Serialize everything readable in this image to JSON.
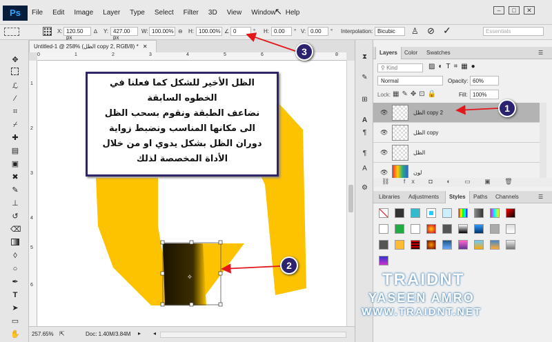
{
  "app": {
    "logo": "Ps"
  },
  "menu": [
    "File",
    "Edit",
    "Image",
    "Layer",
    "Type",
    "Select",
    "Filter",
    "3D",
    "View",
    "Window",
    "Help"
  ],
  "window_controls": [
    "–",
    "□",
    "✕"
  ],
  "options": {
    "x_label": "X:",
    "x_value": "120.50 px",
    "y_label": "Y:",
    "y_value": "427.00 px",
    "w_label": "W:",
    "w_value": "100.00%",
    "h_label": "H:",
    "h_value": "100.00%",
    "angle_value": "0",
    "hskew_label": "H:",
    "hskew_value": "0.00",
    "vskew_label": "V:",
    "vskew_value": "0.00",
    "deg": "°",
    "interp_label": "Interpolation:",
    "interp_value": "Bicubic",
    "workspace": "Essentials"
  },
  "document": {
    "tab_title": "Untitled-1 @ 258% (الظل copy 2, RGB/8) *",
    "ruler_h": [
      "0",
      "1",
      "2",
      "3",
      "4",
      "5",
      "6",
      "7",
      "8"
    ],
    "ruler_v": [
      "1",
      "2",
      "3",
      "4",
      "5",
      "6"
    ],
    "zoom": "257.65%",
    "doc_info": "Doc: 1.40M/3.84M"
  },
  "layers_panel": {
    "tabs": [
      "Layers",
      "Color",
      "Swatches"
    ],
    "kind_label": "Kind",
    "blend_mode": "Normal",
    "opacity_label": "Opacity:",
    "opacity_value": "60%",
    "lock_label": "Lock:",
    "fill_label": "Fill:",
    "fill_value": "100%",
    "layers": [
      {
        "name": "الظل copy 2",
        "selected": true
      },
      {
        "name": "الظل copy",
        "selected": false
      },
      {
        "name": "الظل",
        "selected": false
      },
      {
        "name": "لون",
        "selected": false
      }
    ]
  },
  "styles_panel": {
    "tabs": [
      "Libraries",
      "Adjustments",
      "Styles",
      "Paths",
      "Channels"
    ],
    "active_tab": "Styles"
  },
  "callout": {
    "lines": [
      "الظل الأخير للشكل كما فعلنا في",
      "الخطوه السابقة",
      "نضاعف الطبقة ونقوم بسحب الظل",
      "الى مكانها المناسب ونضبط زواية",
      "دوران الظل بشكل يدوي او من خلال",
      "الأداة المخصصة لذلك"
    ]
  },
  "markers": [
    "1",
    "2",
    "3"
  ],
  "watermark": {
    "brand": "TRAIDNT",
    "author": "YASEEN AMRO",
    "site": "WWW.TRAIDNT.NET"
  },
  "colors": {
    "shape_yellow": "#fdc300",
    "accent_navy": "#2b2270",
    "arrow_red": "#e3161b"
  }
}
